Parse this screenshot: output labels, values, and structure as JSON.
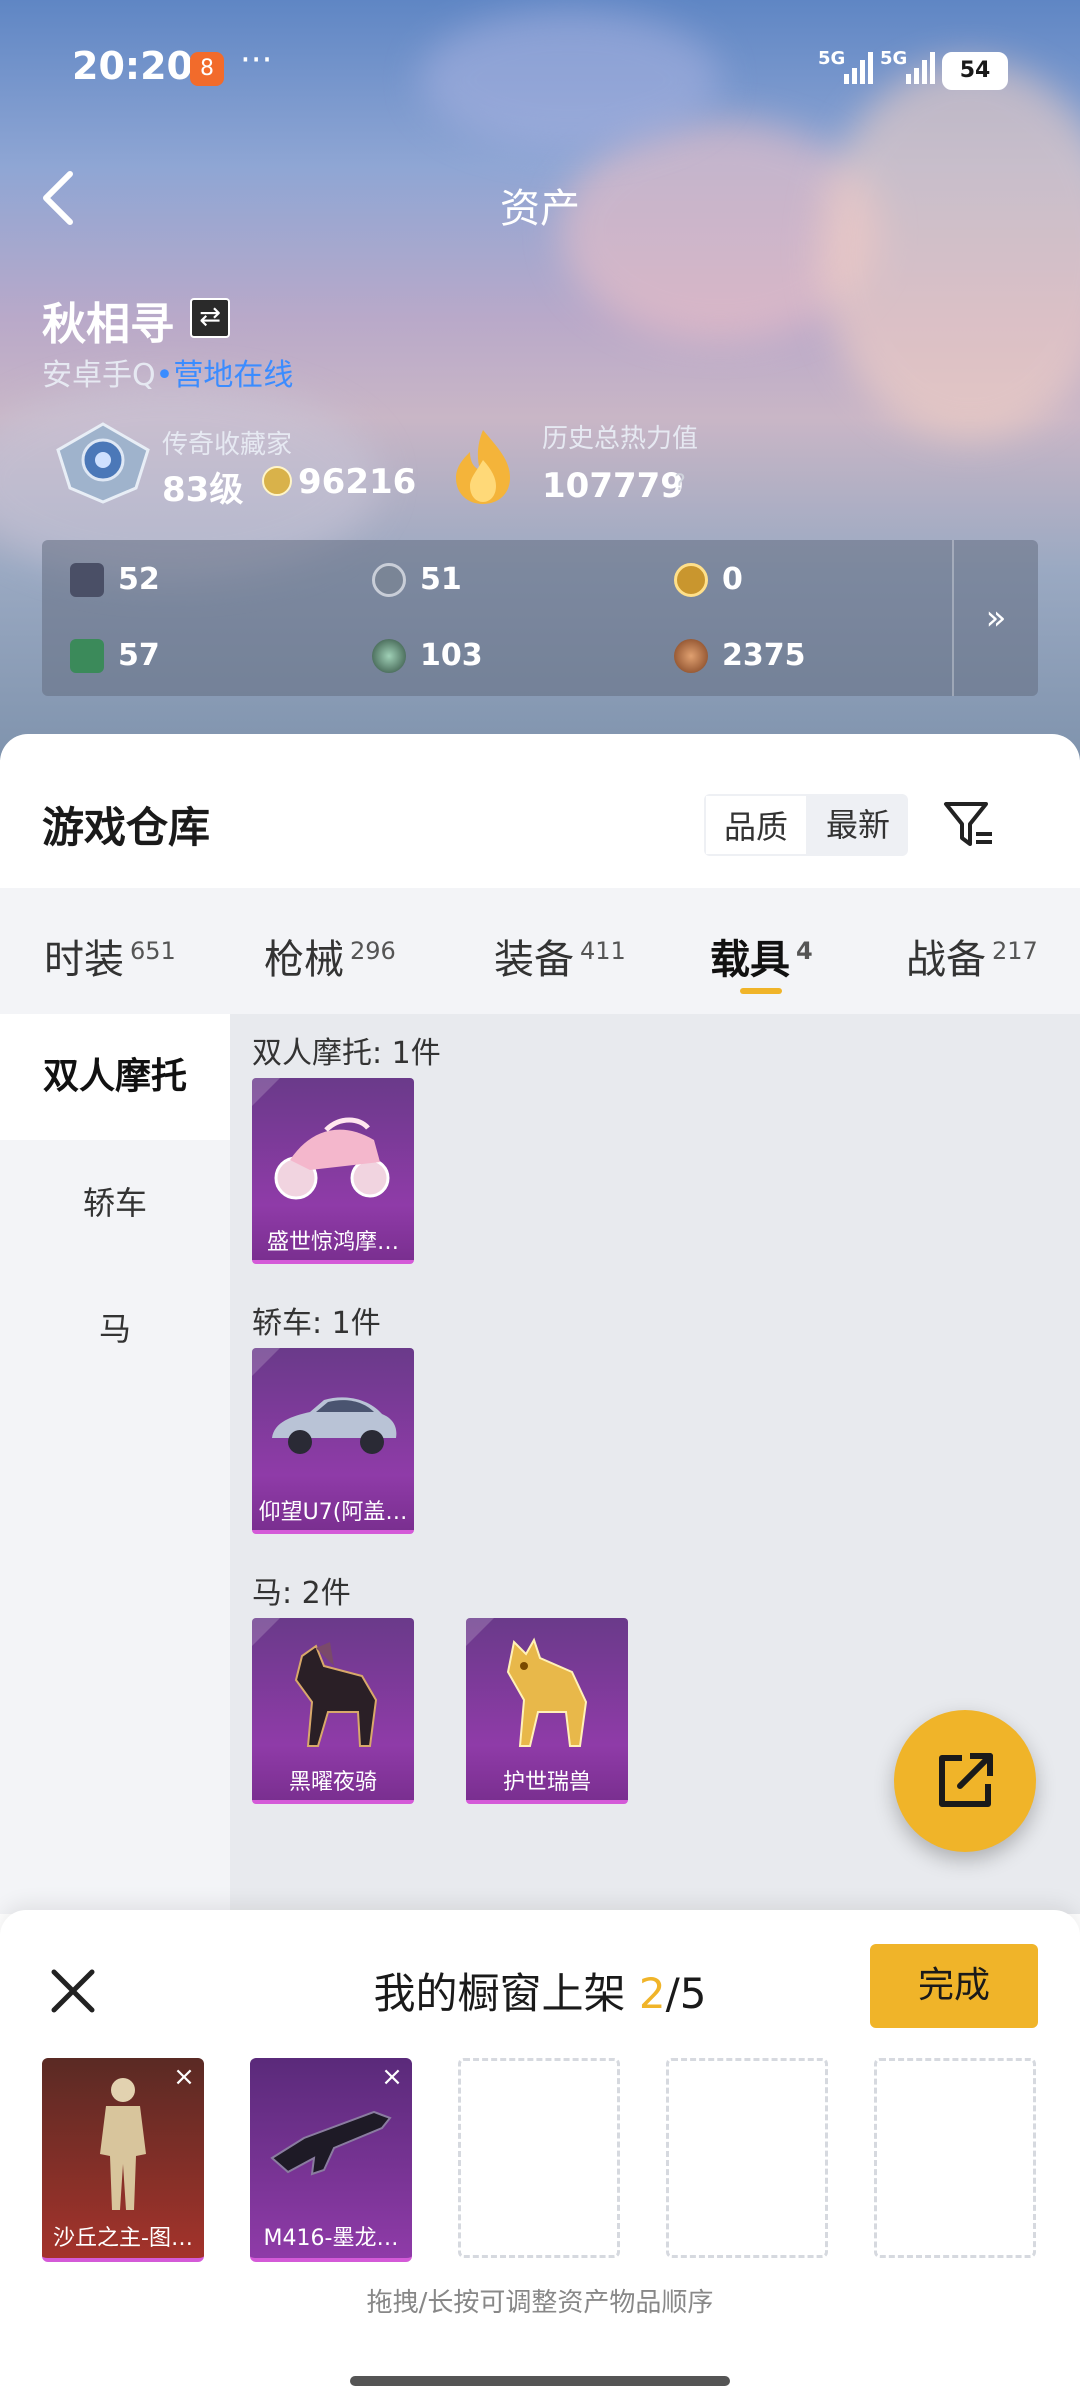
{
  "status": {
    "time": "20:20",
    "app_badge": "8",
    "more": "···",
    "sig1": "5G",
    "sig2": "5G",
    "battery": "54"
  },
  "header": {
    "title": "资产"
  },
  "profile": {
    "name": "秋相寻",
    "swap_icon": "⇄",
    "platform": "安卓手Q",
    "dot": "•",
    "online": "营地在线",
    "rank_label": "传奇收藏家",
    "rank_level": "83级",
    "coins": "96216",
    "heat_label": "历史总热力值",
    "heat_value": "107779",
    "help": "?"
  },
  "stats": [
    {
      "icon": "card-icon",
      "value": "52"
    },
    {
      "icon": "silver-medal-icon",
      "value": "51"
    },
    {
      "icon": "gold-medal-icon",
      "value": "0"
    },
    {
      "icon": "green-card-icon",
      "value": "57"
    },
    {
      "icon": "orb-icon",
      "value": "103"
    },
    {
      "icon": "bronze-coin-icon",
      "value": "2375"
    }
  ],
  "stats_more": "»",
  "warehouse": {
    "title": "游戏仓库",
    "sort_quality": "品质",
    "sort_newest": "最新",
    "tabs": [
      {
        "label": "时装",
        "count": "651"
      },
      {
        "label": "枪械",
        "count": "296"
      },
      {
        "label": "装备",
        "count": "411"
      },
      {
        "label": "载具",
        "count": "4"
      },
      {
        "label": "战备",
        "count": "217"
      }
    ],
    "side": [
      "双人摩托",
      "轿车",
      "马"
    ],
    "groups": [
      {
        "title": "双人摩托: 1件",
        "items": [
          "盛世惊鸿摩…"
        ]
      },
      {
        "title": "轿车: 1件",
        "items": [
          "仰望U7(阿盖…"
        ]
      },
      {
        "title": "马: 2件",
        "items": [
          "黑曜夜骑",
          "护世瑞兽"
        ]
      }
    ]
  },
  "showcase": {
    "title": "我的橱窗上架",
    "current": "2",
    "total": "/5",
    "done": "完成",
    "items": [
      "沙丘之主-图…",
      "M416-墨龙…"
    ],
    "remove": "×",
    "hint": "拖拽/长按可调整资产物品顺序"
  },
  "colors": {
    "accent": "#f0b429",
    "purple": "#8f3ba8",
    "online": "#3b8cff"
  }
}
